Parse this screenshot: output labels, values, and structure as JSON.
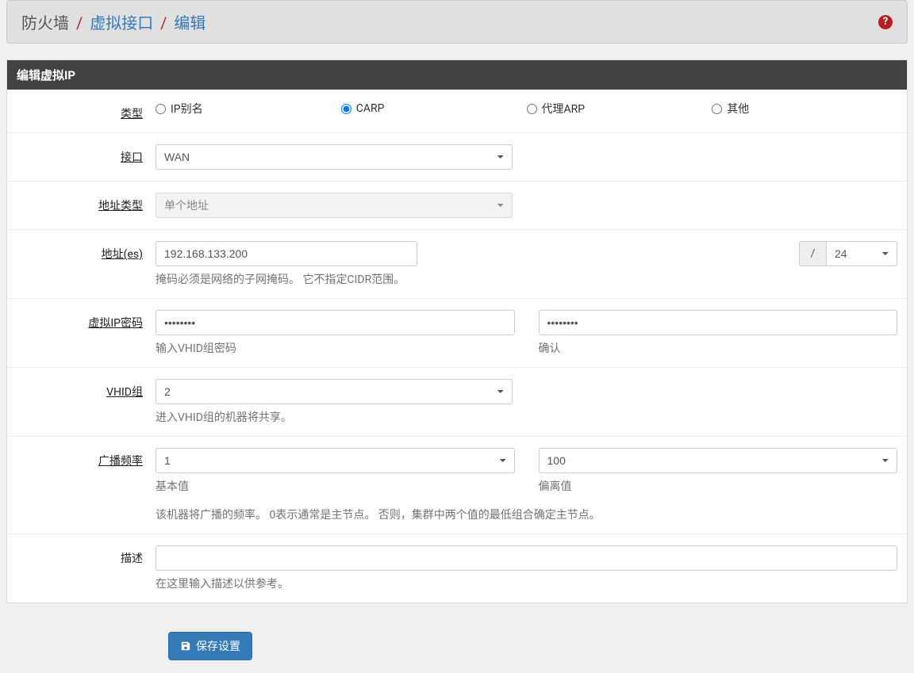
{
  "breadcrumb": {
    "root": "防火墙",
    "mid": "虚拟接口",
    "leaf": "编辑"
  },
  "panel_title": "编辑虚拟IP",
  "labels": {
    "type": "类型",
    "interface": "接口",
    "addr_type": "地址类型",
    "address": "地址(es)",
    "vip_password": "虚拟IP密码",
    "vhid_group": "VHID组",
    "adv_freq": "广播频率",
    "description": "描述"
  },
  "type_options": {
    "ip_alias": "IP别名",
    "carp": "CARP",
    "proxy_arp": "代理ARP",
    "other": "其他",
    "selected": "carp"
  },
  "interface": {
    "value": "WAN"
  },
  "addr_type": {
    "value": "单个地址"
  },
  "address": {
    "value": "192.168.133.200",
    "slash": "/",
    "mask": "24",
    "help": "掩码必须是网络的子网掩码。 它不指定CIDR范围。"
  },
  "vip_password": {
    "value": "••••••••",
    "help": "输入VHID组密码",
    "confirm_value": "••••••••",
    "confirm_help": "确认"
  },
  "vhid": {
    "value": "2",
    "help": "进入VHID组的机器将共享。"
  },
  "adv_freq": {
    "base": "1",
    "base_help": "基本值",
    "skew": "100",
    "skew_help": "偏离值",
    "long_help": "该机器将广播的频率。 0表示通常是主节点。 否则，集群中两个值的最低组合确定主节点。"
  },
  "description": {
    "value": "",
    "help": "在这里输入描述以供参考。"
  },
  "save_label": "保存设置"
}
